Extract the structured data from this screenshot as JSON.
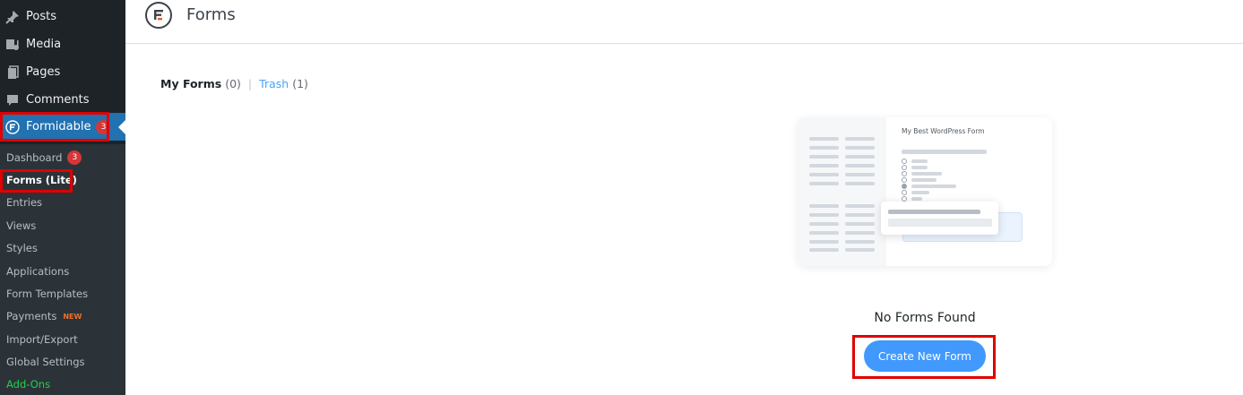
{
  "sidebar": {
    "menu": [
      {
        "label": "Posts",
        "icon": "pushpin-icon"
      },
      {
        "label": "Media",
        "icon": "media-icon"
      },
      {
        "label": "Pages",
        "icon": "pages-icon"
      },
      {
        "label": "Comments",
        "icon": "comment-icon"
      },
      {
        "label": "Formidable",
        "icon": "formidable-logo-icon",
        "badge": "3",
        "active": true
      }
    ],
    "submenu": [
      {
        "label": "Dashboard",
        "badge": "3"
      },
      {
        "label": "Forms (Lite)",
        "current": true
      },
      {
        "label": "Entries"
      },
      {
        "label": "Views"
      },
      {
        "label": "Styles"
      },
      {
        "label": "Applications"
      },
      {
        "label": "Form Templates"
      },
      {
        "label": "Payments",
        "tag": "NEW"
      },
      {
        "label": "Import/Export"
      },
      {
        "label": "Global Settings"
      },
      {
        "label": "Add-Ons"
      }
    ]
  },
  "header": {
    "title": "Forms",
    "logo_icon": "formidable-logo-icon"
  },
  "views": {
    "my_forms": {
      "label": "My Forms",
      "count": "(0)"
    },
    "trash": {
      "label": "Trash",
      "count": "(1)"
    }
  },
  "illustration": {
    "title": "My Best WordPress Form"
  },
  "empty_state": {
    "message": "No Forms Found",
    "button": "Create New Form"
  },
  "colors": {
    "sidebar_bg": "#1d2327",
    "active": "#2271b1",
    "button": "#4199fd",
    "badge": "#d63638",
    "highlight": "#e00000",
    "link": "#4aa3f7"
  }
}
